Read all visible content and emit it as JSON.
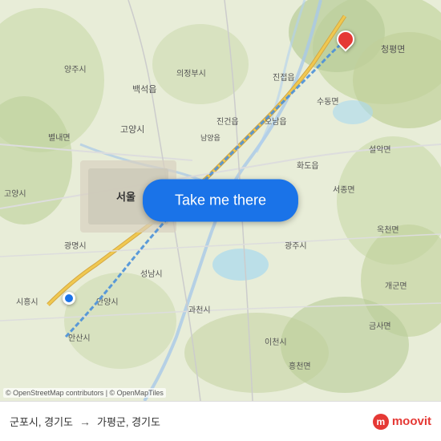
{
  "map": {
    "background_color": "#e8f0d8",
    "attribution": "© OpenStreetMap contributors | © OpenMapTiles"
  },
  "button": {
    "label": "Take me there",
    "bg_color": "#1a73e8",
    "text_color": "#ffffff"
  },
  "footer": {
    "origin": "군포시, 경기도",
    "arrow": "→",
    "destination": "가평군, 경기도",
    "logo_text": "moovit"
  },
  "pins": {
    "origin": {
      "color": "#1a73e8",
      "position": "bottom-left"
    },
    "destination": {
      "color": "#e53935",
      "position": "top-right"
    }
  }
}
